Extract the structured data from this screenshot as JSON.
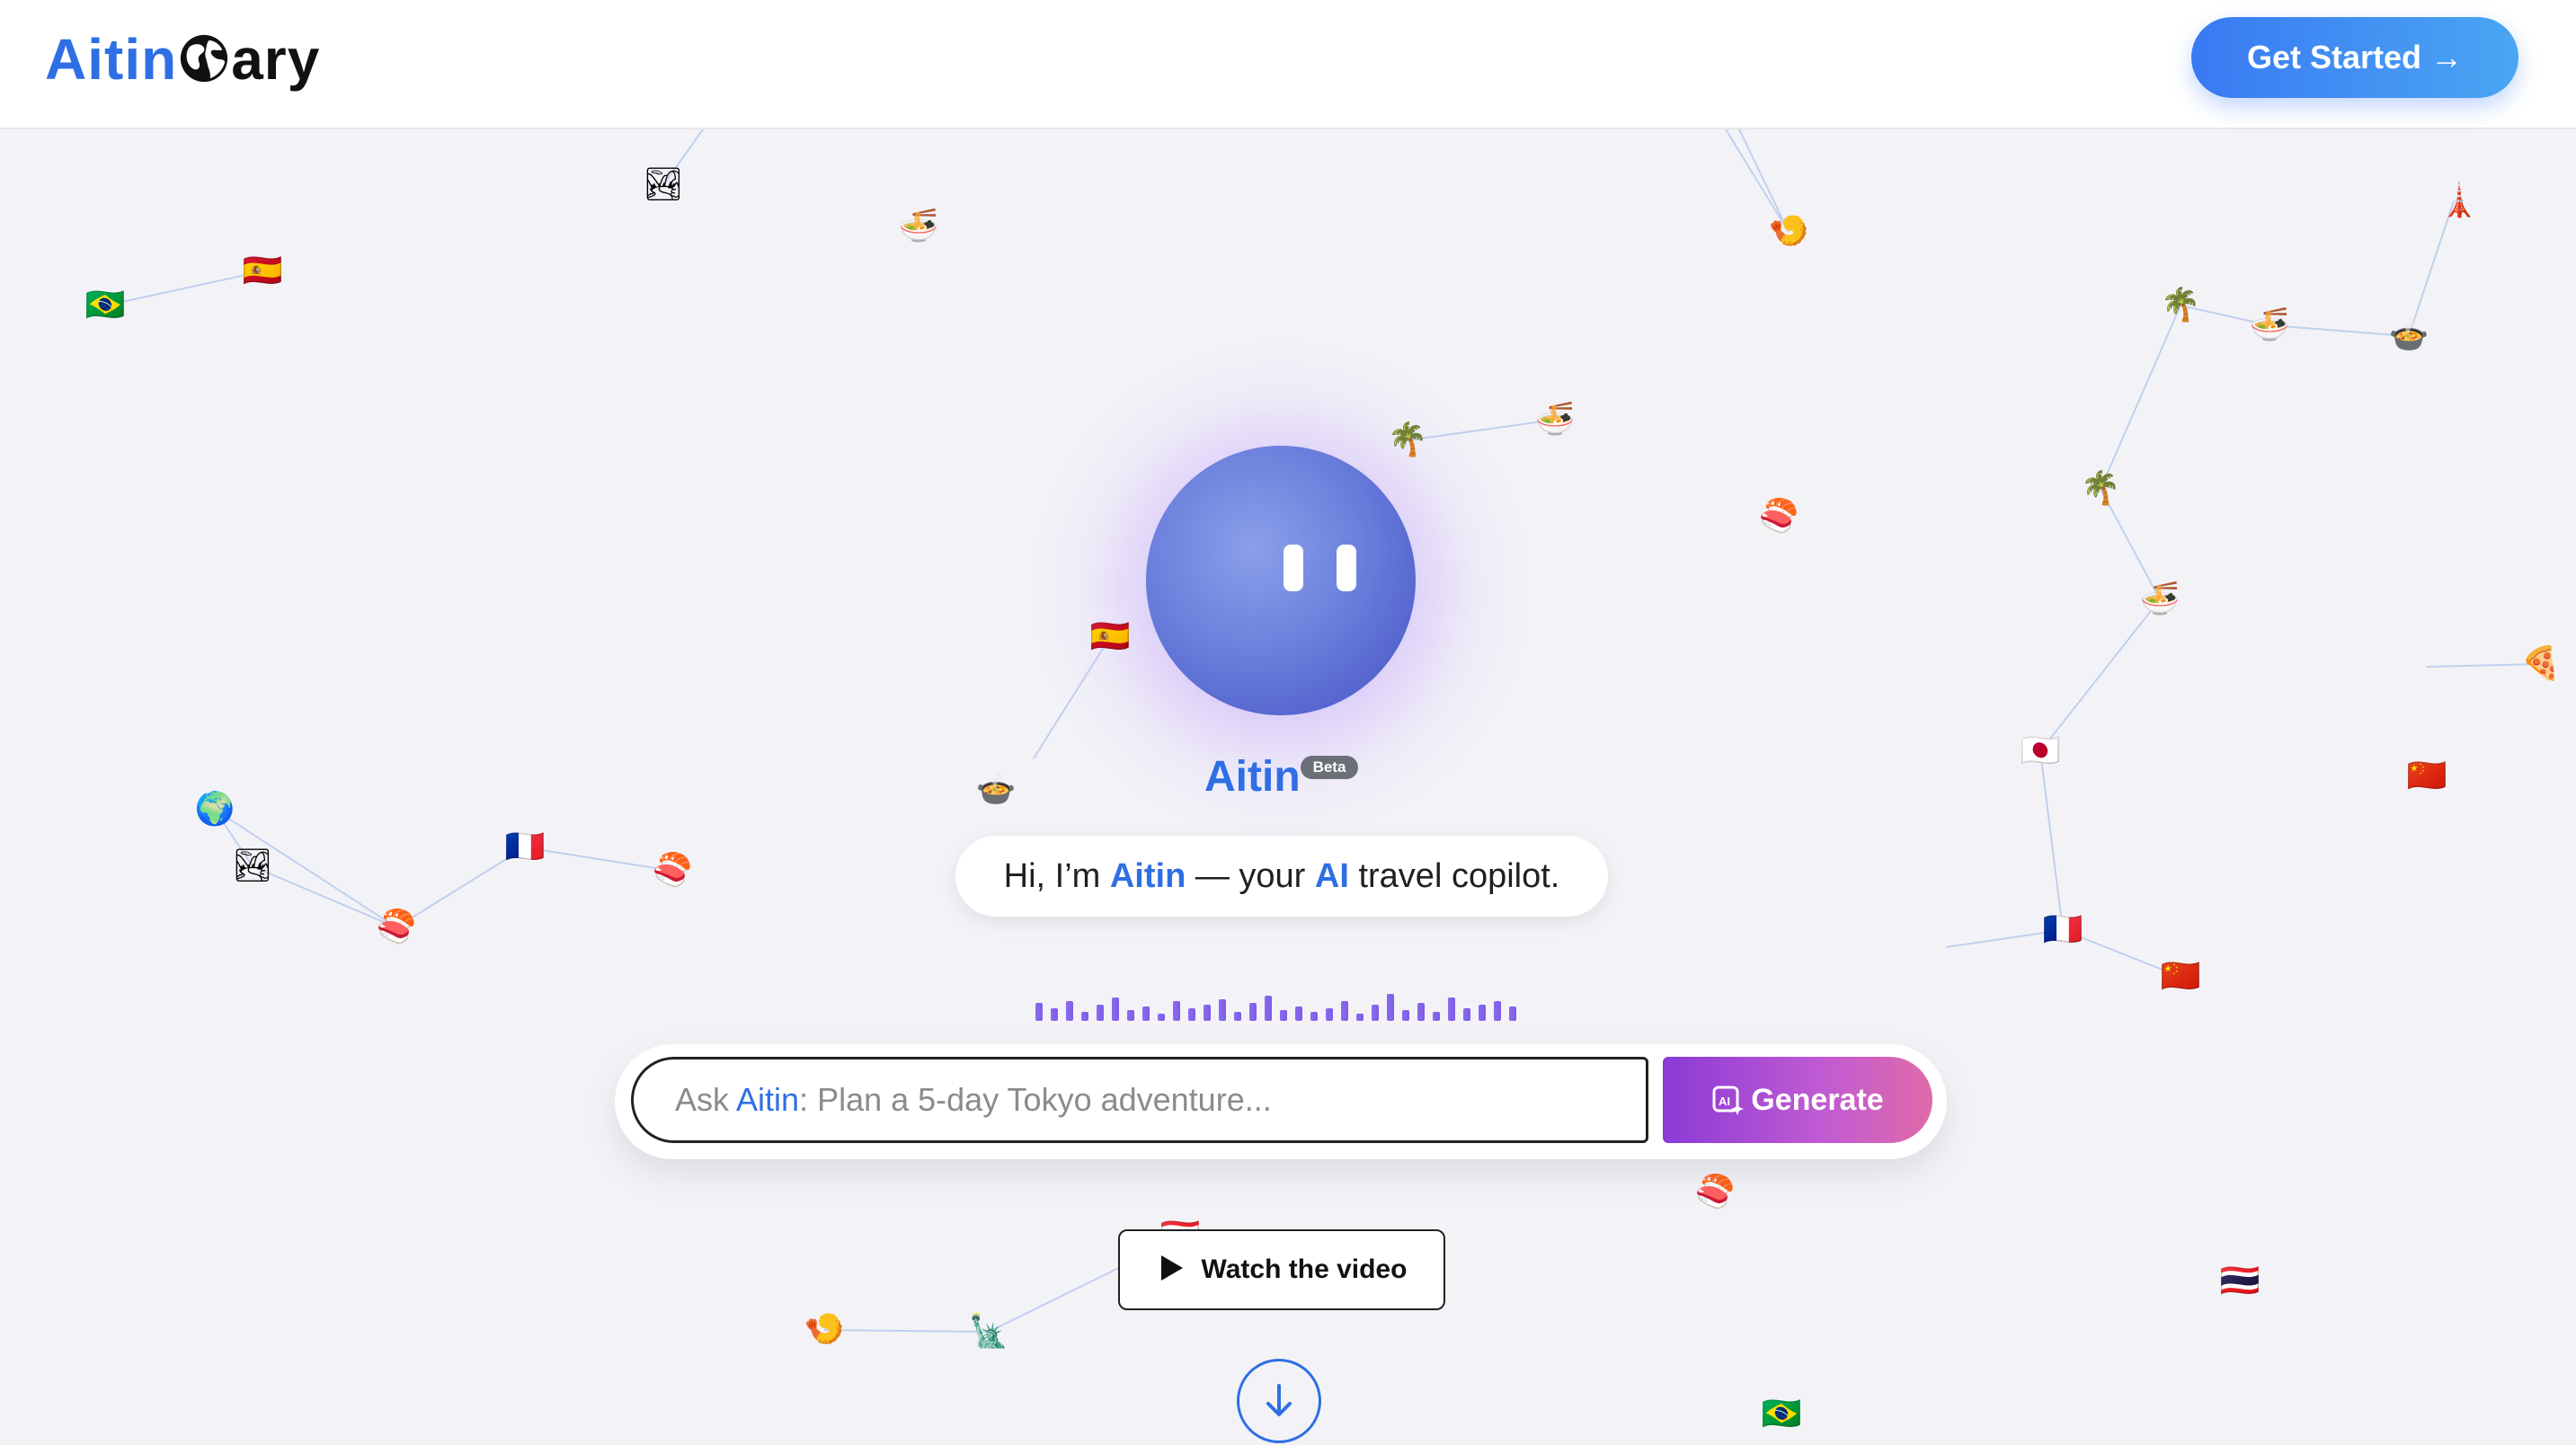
{
  "header": {
    "logo": {
      "part1": "Aitin",
      "icon": "globe-icon",
      "part2": "ary"
    },
    "cta_label": "Get Started →"
  },
  "hero": {
    "assistant_name": "Aitin",
    "badge": "Beta",
    "greeting": {
      "before": "Hi, I’m ",
      "name": "Aitin",
      "mid": " — your ",
      "ai": "AI",
      "after": " travel copilot."
    },
    "search": {
      "prefix": "Ask ",
      "name": "Aitin",
      "suffix": ": Plan a 5-day Tokyo adventure..."
    },
    "generate_label": "Generate",
    "watch_label": "Watch the video"
  },
  "colors": {
    "brand_blue": "#2f6fe4",
    "generate_purple": "#8b3ad6",
    "generate_pink": "#e06aa8",
    "background": "#f3f3f7"
  },
  "background_icons": [
    {
      "glyph": "🇧🇷",
      "name": "brazil-flag-icon"
    },
    {
      "glyph": "🇪🇸",
      "name": "spain-flag-icon"
    },
    {
      "glyph": "🏞",
      "name": "landscape-icon"
    },
    {
      "glyph": "🍜",
      "name": "noodles-icon"
    },
    {
      "glyph": "🍤",
      "name": "shrimp-icon"
    },
    {
      "glyph": "🗼",
      "name": "tower-icon"
    },
    {
      "glyph": "🌴",
      "name": "palm-tree-icon"
    },
    {
      "glyph": "🍜",
      "name": "noodles-icon"
    },
    {
      "glyph": "🍲",
      "name": "food-bowl-icon"
    },
    {
      "glyph": "🌴",
      "name": "palm-tree-icon"
    },
    {
      "glyph": "🍜",
      "name": "noodles-icon"
    },
    {
      "glyph": "🍣",
      "name": "sushi-icon"
    },
    {
      "glyph": "🌴",
      "name": "palm-tree-icon"
    },
    {
      "glyph": "🍜",
      "name": "noodles-icon"
    },
    {
      "glyph": "🇪🇸",
      "name": "spain-flag-icon"
    },
    {
      "glyph": "🍕",
      "name": "pizza-icon"
    },
    {
      "glyph": "🇯🇵",
      "name": "japan-flag-icon"
    },
    {
      "glyph": "🇨🇳",
      "name": "china-flag-icon"
    },
    {
      "glyph": "🌍",
      "name": "earth-globe-icon"
    },
    {
      "glyph": "🏞",
      "name": "landscape-icon"
    },
    {
      "glyph": "🇫🇷",
      "name": "france-flag-icon"
    },
    {
      "glyph": "🍣",
      "name": "sushi-icon"
    },
    {
      "glyph": "🍣",
      "name": "sushi-icon"
    },
    {
      "glyph": "🍲",
      "name": "food-bowl-icon"
    },
    {
      "glyph": "🇫🇷",
      "name": "france-flag-icon"
    },
    {
      "glyph": "🇨🇳",
      "name": "china-flag-icon"
    },
    {
      "glyph": "🍣",
      "name": "sushi-icon"
    },
    {
      "glyph": "🇹🇭",
      "name": "thailand-flag-icon"
    },
    {
      "glyph": "🌴",
      "name": "palm-tree-icon"
    },
    {
      "glyph": "🇹🇭",
      "name": "thailand-flag-icon"
    },
    {
      "glyph": "🍤",
      "name": "shrimp-icon"
    },
    {
      "glyph": "🗽",
      "name": "statue-of-liberty-icon"
    },
    {
      "glyph": "🇧🇷",
      "name": "brazil-flag-icon"
    }
  ]
}
